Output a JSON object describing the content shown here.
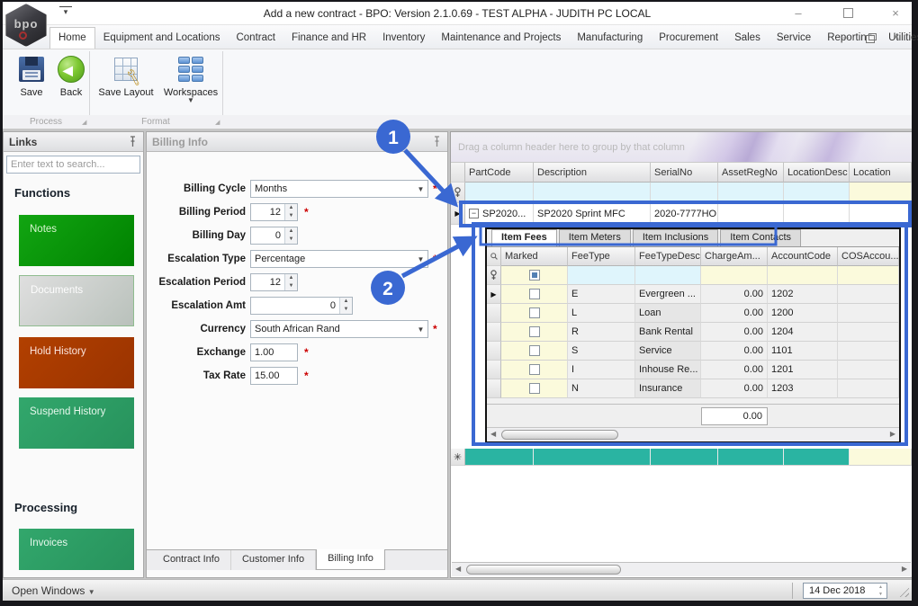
{
  "window": {
    "title": "Add a new contract - BPO: Version 2.1.0.69 - TEST ALPHA - JUDITH PC LOCAL",
    "logo_text": "bpo",
    "controls": {
      "minimize": "–",
      "close": "×"
    }
  },
  "ribbon": {
    "tabs": [
      "Home",
      "Equipment and Locations",
      "Contract",
      "Finance and HR",
      "Inventory",
      "Maintenance and Projects",
      "Manufacturing",
      "Procurement",
      "Sales",
      "Service",
      "Reporting",
      "Utilities"
    ],
    "active_tab": "Home",
    "buttons": {
      "save": "Save",
      "back": "Back",
      "save_layout": "Save Layout",
      "workspaces": "Workspaces"
    },
    "groups": {
      "process": "Process",
      "format": "Format"
    },
    "mdi": {
      "minimize": "–",
      "close": "×"
    }
  },
  "links_panel": {
    "title": "Links",
    "search_placeholder": "Enter text to search...",
    "functions_heading": "Functions",
    "processing_heading": "Processing",
    "buttons": {
      "notes": "Notes",
      "documents": "Documents",
      "hold_history": "Hold History",
      "suspend_history": "Suspend History",
      "invoices": "Invoices"
    }
  },
  "billing_panel": {
    "title": "Billing Info",
    "fields": [
      {
        "label": "Billing Cycle",
        "value": "Months",
        "required": "*"
      },
      {
        "label": "Billing Period",
        "value": "12",
        "required": "*"
      },
      {
        "label": "Billing Day",
        "value": "0",
        "required": ""
      },
      {
        "label": "Escalation Type",
        "value": "Percentage",
        "required": "*"
      },
      {
        "label": "Escalation Period",
        "value": "12",
        "required": ""
      },
      {
        "label": "Escalation Amt",
        "value": "0",
        "required": ""
      },
      {
        "label": "Currency",
        "value": "South African Rand",
        "required": "*"
      },
      {
        "label": "Exchange",
        "value": "1.00",
        "required": "*"
      },
      {
        "label": "Tax Rate",
        "value": "15.00",
        "required": "*"
      }
    ],
    "tabs": [
      "Contract Info",
      "Customer Info",
      "Billing Info"
    ],
    "active_tab": "Billing Info"
  },
  "grid": {
    "group_hint": "Drag a column header here to group by that column",
    "columns": [
      "PartCode",
      "Description",
      "SerialNo",
      "AssetRegNo",
      "LocationDesc",
      "Location"
    ],
    "row": {
      "part_code": "SP2020...",
      "description": "SP2020 Sprint MFC",
      "serial_no": "2020-7777HO",
      "asset_reg_no": "",
      "location_desc": "",
      "location": ""
    }
  },
  "detail_grid": {
    "tabs": [
      "Item Fees",
      "Item Meters",
      "Item Inclusions",
      "Item Contacts"
    ],
    "active_tab": "Item Fees",
    "columns": [
      "Marked",
      "FeeType",
      "FeeTypeDesc",
      "ChargeAm...",
      "AccountCode",
      "COSAccou..."
    ],
    "rows": [
      {
        "fee_type": "E",
        "fee_type_desc": "Evergreen ...",
        "charge": "0.00",
        "account_code": "1202"
      },
      {
        "fee_type": "L",
        "fee_type_desc": "Loan",
        "charge": "0.00",
        "account_code": "1200"
      },
      {
        "fee_type": "R",
        "fee_type_desc": "Bank Rental",
        "charge": "0.00",
        "account_code": "1204"
      },
      {
        "fee_type": "S",
        "fee_type_desc": "Service",
        "charge": "0.00",
        "account_code": "1101"
      },
      {
        "fee_type": "I",
        "fee_type_desc": "Inhouse Re...",
        "charge": "0.00",
        "account_code": "1201"
      },
      {
        "fee_type": "N",
        "fee_type_desc": "Insurance",
        "charge": "0.00",
        "account_code": "1203"
      }
    ],
    "summary_total": "0.00"
  },
  "status_bar": {
    "open_windows": "Open Windows",
    "date": "14 Dec 2018"
  },
  "annotations": {
    "step1": "1",
    "step2": "2",
    "color": "#3A68D2"
  },
  "colors": {
    "annotation_blue": "#3A68D2",
    "teal_new_row": "#2AB4A2",
    "notes_green": "#009B07",
    "hold_history_red": "#AC3A00",
    "emerald_green": "#2EA167",
    "filter_row_cyan": "#DFF5FC",
    "filter_row_yellow": "#FBFADC"
  }
}
